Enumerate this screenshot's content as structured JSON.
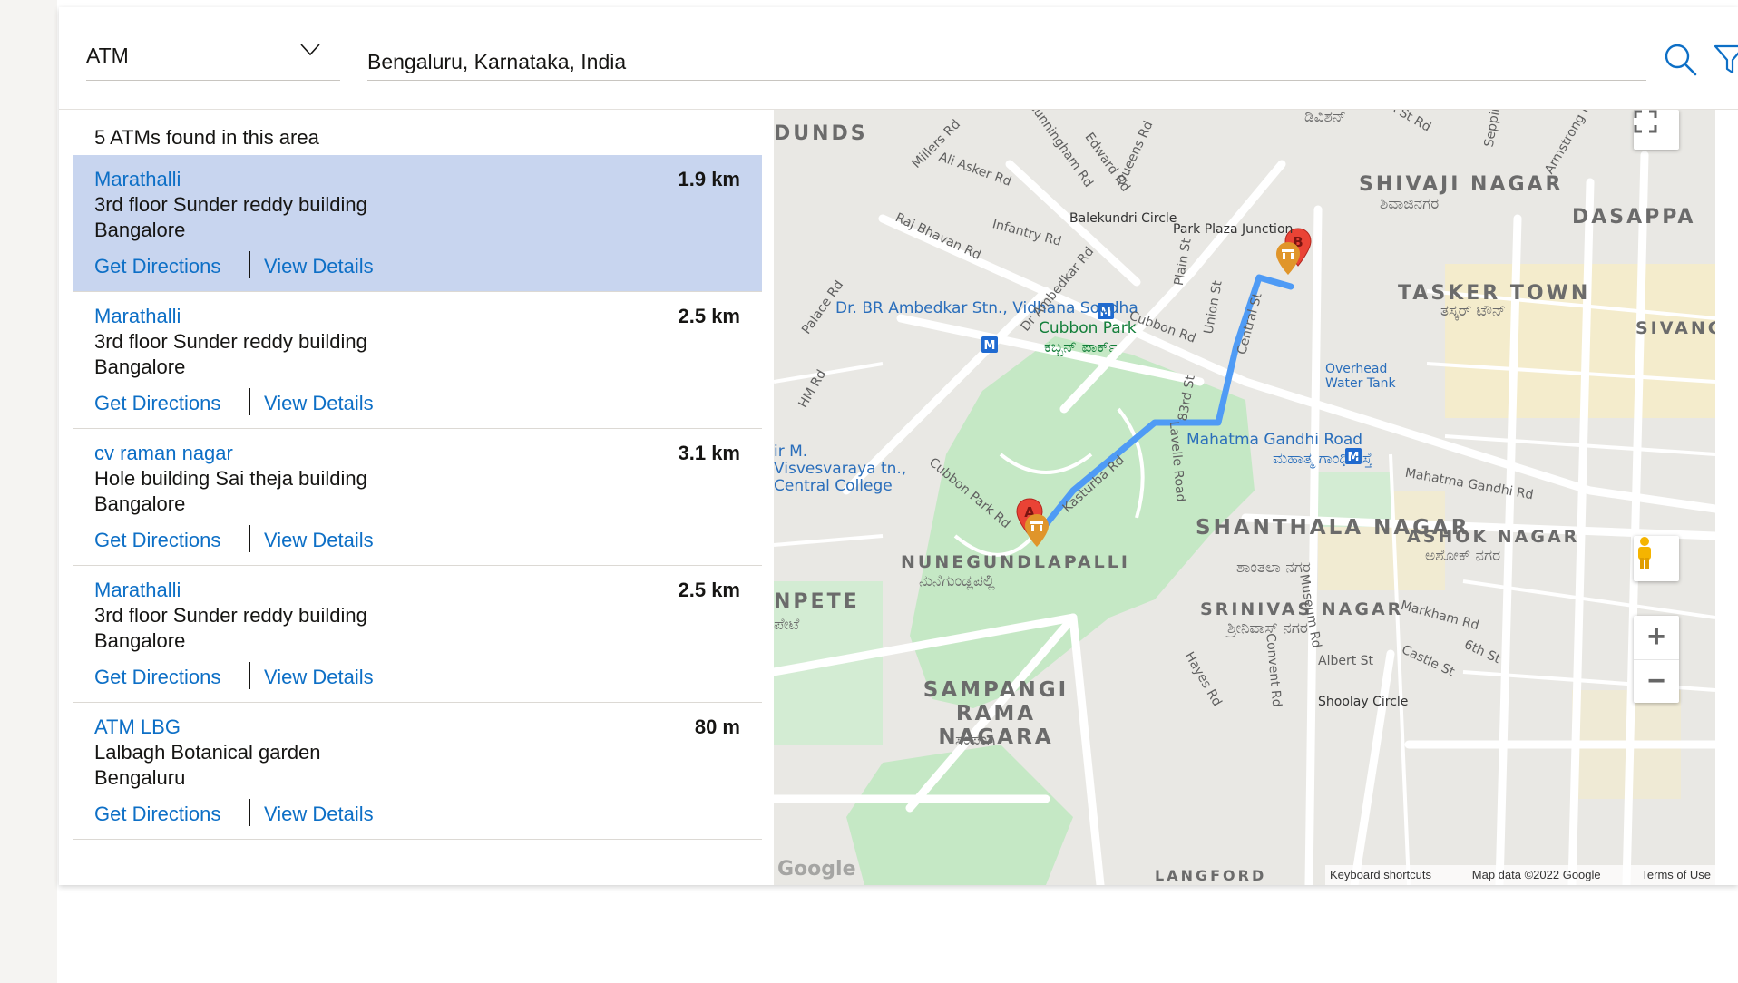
{
  "search": {
    "type_value": "ATM",
    "location_value": "Bengaluru, Karnataka, India"
  },
  "results": {
    "count_text": "5 ATMs found in this area",
    "items": [
      {
        "name": "Marathalli",
        "distance": "1.9 km",
        "line1": "3rd floor Sunder reddy building",
        "line2": "Bangalore",
        "directions": "Get Directions",
        "details": "View Details"
      },
      {
        "name": "Marathalli",
        "distance": "2.5 km",
        "line1": "3rd floor Sunder reddy building",
        "line2": "Bangalore",
        "directions": "Get Directions",
        "details": "View Details"
      },
      {
        "name": "cv raman nagar",
        "distance": "3.1 km",
        "line1": "Hole building Sai theja building",
        "line2": "Bangalore",
        "directions": "Get Directions",
        "details": "View Details"
      },
      {
        "name": "Marathalli",
        "distance": "2.5 km",
        "line1": "3rd floor Sunder reddy building",
        "line2": "Bangalore",
        "directions": "Get Directions",
        "details": "View Details"
      },
      {
        "name": "ATM LBG",
        "distance": "80 m",
        "line1": "Lalbagh Botanical garden",
        "line2": "Bengaluru",
        "directions": "Get Directions",
        "details": "View Details"
      }
    ]
  },
  "map": {
    "markers": {
      "start": "A",
      "end": "B"
    },
    "streets": [
      "Millers Rd",
      "Ali Asker Rd",
      "Cunningham Rd",
      "Edward Rd",
      "Queens Rd",
      "Raj Bhavan Rd",
      "Infantry Rd",
      "Palace Rd",
      "Dr Ambedkar Rd",
      "Cubbon Rd",
      "Central St",
      "Union St",
      "Plain St",
      "Kasturba Rd",
      "Cubbon Park Rd",
      "Lavelle Road",
      "Museum Rd",
      "Convent Rd",
      "Hayes Rd",
      "Markham Rd",
      "Albert St",
      "Castle St",
      "6th St",
      "HM Rd",
      "83rd St",
      "A St Rd",
      "Armstrong Rd",
      "Sepping",
      "Mahatma Gandhi Rd"
    ],
    "areas": [
      "SHIVAJI NAGAR",
      "DASAPPA",
      "TASKER TOWN",
      "SIVANC GARD",
      "SHANTHALA NAGAR",
      "ASHOK NAGAR",
      "NUNEGUNDLAPALLI",
      "SRINIVAS NAGAR",
      "SAMPANGI RAMA NAGARA",
      "DUNDS",
      "NPETE",
      "LANGFORD"
    ],
    "kannada": [
      "ಶಿವಾಜಿನಗರ",
      "ತಸ್ಕರ್ ಟೌನ್",
      "ಶಾಂತಲಾ ನಗರ",
      "ಅಶೋಕ್ ನಗರ",
      "ನುನೆಗುಂಡ್ಲಪಲ್ಲಿ",
      "ಶ್ರೀನಿವಾಸ್ ನಗರ",
      "ಸಂಪಂಗಿ",
      "ಡಿವಿಶನ್",
      "ಕಬ್ಬನ್ ಪಾರ್ಕ್",
      "ಮಹಾತ್ಮ ಗಾಂಧಿ ರಸ್ತೆ",
      "ಪೇಟೆ"
    ],
    "pois": {
      "junction1": "Balekundri Circle",
      "junction2": "Park Plaza Junction",
      "ambedkar": "Dr. BR Ambedkar Stn., Vidhana Soudha",
      "cubbon": "Cubbon Park",
      "mg_road": "Mahatma Gandhi Road",
      "visvesvaraya": "ir M. Visvesvaraya tn., Central College",
      "tank": "Overhead Water Tank",
      "shoolay": "Shoolay Circle"
    },
    "attribution": {
      "keys": "Keyboard shortcuts",
      "data": "Map data ©2022 Google",
      "terms": "Terms of Use",
      "logo": "Google"
    },
    "controls": {
      "zoom_in": "+",
      "zoom_out": "−"
    }
  },
  "colors": {
    "accent": "#0d6fc6",
    "selected_row": "#c8d5ef",
    "route": "#4f9bf5",
    "park": "#c5e8c5",
    "marker": "#ea4335"
  }
}
